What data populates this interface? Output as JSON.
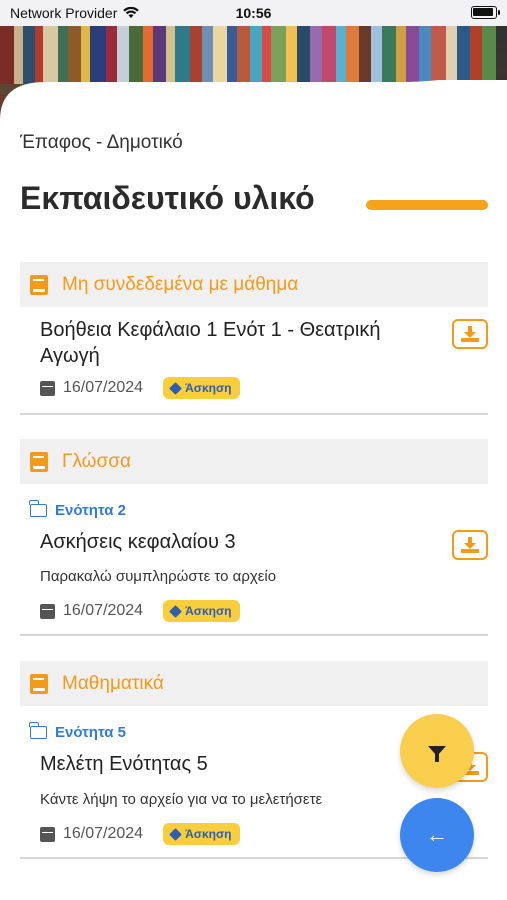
{
  "status_bar": {
    "carrier": "Network Provider",
    "time": "10:56"
  },
  "breadcrumb": "Έπαφος - Δημοτικό",
  "page_title": "Εκπαιδευτικό υλικό",
  "sections": [
    {
      "title": "Μη συνδεδεμένα με μάθημα",
      "item": {
        "unit": "",
        "title": "Βοήθεια Κεφάλαιο 1 Ενότ 1 - Θεατρική Αγωγή",
        "description": "",
        "date": "16/07/2024",
        "tag": "Άσκηση"
      }
    },
    {
      "title": "Γλώσσα",
      "item": {
        "unit": "Ενότητα 2",
        "title": "Ασκήσεις κεφαλαίου 3",
        "description": "Παρακαλώ συμπληρώστε το αρχείο",
        "date": "16/07/2024",
        "tag": "Άσκηση"
      }
    },
    {
      "title": "Μαθηματικά",
      "item": {
        "unit": "Ενότητα 5",
        "title": "Μελέτη Ενότητας 5",
        "description": "Κάντε λήψη το αρχείο για να το μελετήσετε",
        "date": "16/07/2024",
        "tag": "Άσκηση"
      }
    }
  ],
  "icons": {
    "section": "book-icon",
    "unit": "folder-icon",
    "date": "calendar-icon",
    "tag": "tag-icon",
    "download": "download-icon",
    "filter": "filter-icon",
    "back": "arrow-left-icon"
  },
  "colors": {
    "accent": "#f39a1a",
    "link": "#2f7bdc",
    "badge": "#f9ce3c",
    "fab_filter": "#f9ce4c",
    "fab_back": "#3d86ee"
  }
}
